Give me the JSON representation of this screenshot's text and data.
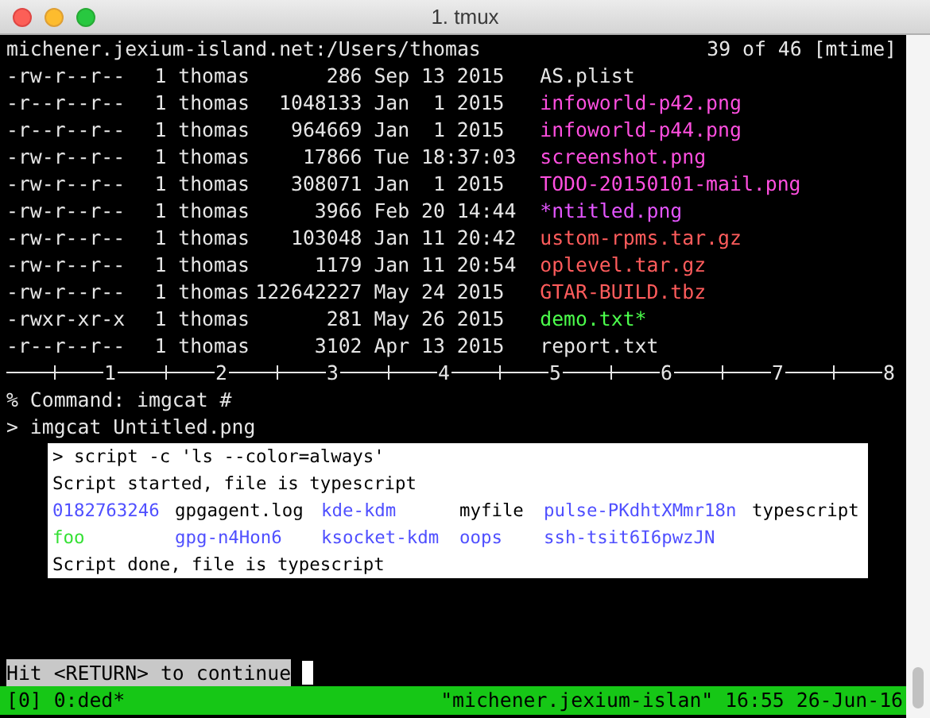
{
  "window": {
    "title": "1. tmux"
  },
  "header": {
    "path": "michener.jexium-island.net:/Users/thomas",
    "position": "39 of 46 [mtime]"
  },
  "files": [
    {
      "perms": "-rw-r--r--",
      "links": "1",
      "owner": "thomas",
      "size": "286",
      "date": "Sep 13 2015",
      "name": "AS.plist",
      "color": "#e6e6e6"
    },
    {
      "perms": "-r--r--r--",
      "links": "1",
      "owner": "thomas",
      "size": "1048133",
      "date": "Jan  1 2015",
      "name": "infoworld-p42.png",
      "color": "#ff4fe0"
    },
    {
      "perms": "-r--r--r--",
      "links": "1",
      "owner": "thomas",
      "size": "964669",
      "date": "Jan  1 2015",
      "name": "infoworld-p44.png",
      "color": "#ff4fe0"
    },
    {
      "perms": "-rw-r--r--",
      "links": "1",
      "owner": "thomas",
      "size": "17866",
      "date": "Tue 18:37:03",
      "name": "screenshot.png",
      "color": "#ff4fe0"
    },
    {
      "perms": "-rw-r--r--",
      "links": "1",
      "owner": "thomas",
      "size": "308071",
      "date": "Jan  1 2015",
      "name": "TODO-20150101-mail.png",
      "color": "#ff4fe0"
    },
    {
      "perms": "-rw-r--r--",
      "links": "1",
      "owner": "thomas",
      "size": "3966",
      "date": "Feb 20 14:44",
      "name": "*ntitled.png",
      "color": "#e455ff"
    },
    {
      "perms": "-rw-r--r--",
      "links": "1",
      "owner": "thomas",
      "size": "103048",
      "date": "Jan 11 20:42",
      "name": "ustom-rpms.tar.gz",
      "color": "#ff5c5c"
    },
    {
      "perms": "-rw-r--r--",
      "links": "1",
      "owner": "thomas",
      "size": "1179",
      "date": "Jan 11 20:54",
      "name": "oplevel.tar.gz",
      "color": "#ff5c5c"
    },
    {
      "perms": "-rw-r--r--",
      "links": "1",
      "owner": "thomas",
      "size": "122642227",
      "date": "May 24 2015",
      "name": "GTAR-BUILD.tbz",
      "color": "#ff5c5c"
    },
    {
      "perms": "-rwxr-xr-x",
      "links": "1",
      "owner": "thomas",
      "size": "281",
      "date": "May 26 2015",
      "name": "demo.txt*",
      "color": "#4cff4c"
    },
    {
      "perms": "-r--r--r--",
      "links": "1",
      "owner": "thomas",
      "size": "3102",
      "date": "Apr 13 2015",
      "name": "report.txt",
      "color": "#e6e6e6"
    }
  ],
  "ruler": [
    "1",
    "2",
    "3",
    "4",
    "5",
    "6",
    "7",
    "8"
  ],
  "command_prompt": "% Command: imgcat #",
  "command": "> imgcat Untitled.png",
  "image": {
    "lines": [
      {
        "kind": "text",
        "text": "> script -c 'ls --color=always'"
      },
      {
        "kind": "text",
        "text": "Script started, file is typescript"
      },
      {
        "kind": "listing",
        "items": [
          {
            "text": "0182763246",
            "color": "#4f4fff"
          },
          {
            "text": "gpgagent.log",
            "color": "#000000"
          },
          {
            "text": "kde-kdm",
            "color": "#4f4fff"
          },
          {
            "text": "myfile",
            "color": "#000000"
          },
          {
            "text": "pulse-PKdhtXMmr18n",
            "color": "#4f4fff"
          },
          {
            "text": "typescript",
            "color": "#000000"
          },
          {
            "text": "foo",
            "color": "#33e033"
          },
          {
            "text": "gpg-n4Hon6",
            "color": "#4f4fff"
          },
          {
            "text": "ksocket-kdm",
            "color": "#4f4fff"
          },
          {
            "text": "oops",
            "color": "#4f4fff"
          },
          {
            "text": "ssh-tsit6I6pwzJN",
            "color": "#4f4fff"
          }
        ]
      },
      {
        "kind": "text",
        "text": "Script done, file is typescript"
      }
    ]
  },
  "message": "Hit <RETURN> to continue",
  "status_bar": {
    "left": "[0] 0:ded*",
    "right": "\"michener.jexium-islan\" 16:55 26-Jun-16"
  }
}
